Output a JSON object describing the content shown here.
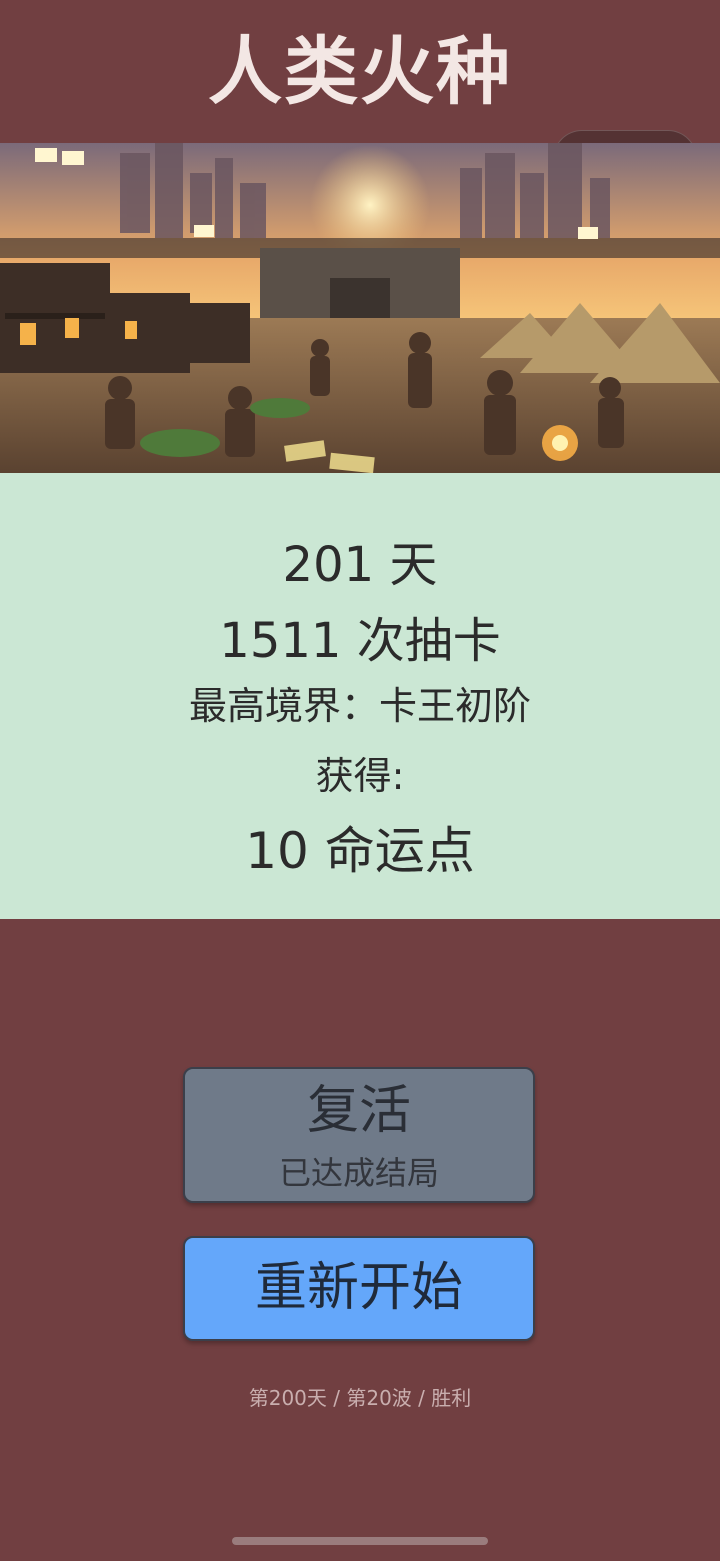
{
  "app": {
    "title": "人类火种"
  },
  "capsule": {
    "more_icon": "more-dots-icon",
    "close_icon": "close-target-icon"
  },
  "banner": {
    "alt": "survivor camp illustration"
  },
  "stats": {
    "days": "201 天",
    "draws": "1511 次抽卡",
    "highest_realm": "最高境界：卡王初阶",
    "obtained_label": "获得:",
    "fate_points": "10 命运点"
  },
  "actions": {
    "revive_label": "复活",
    "revive_sub": "已达成结局",
    "restart_label": "重新开始"
  },
  "footer": {
    "status": "第200天 / 第20波 / 胜利"
  },
  "colors": {
    "background": "#713f41",
    "stats_panel": "#cbe7d4",
    "revive_button": "#6f7a89",
    "restart_button": "#64a7fa"
  }
}
